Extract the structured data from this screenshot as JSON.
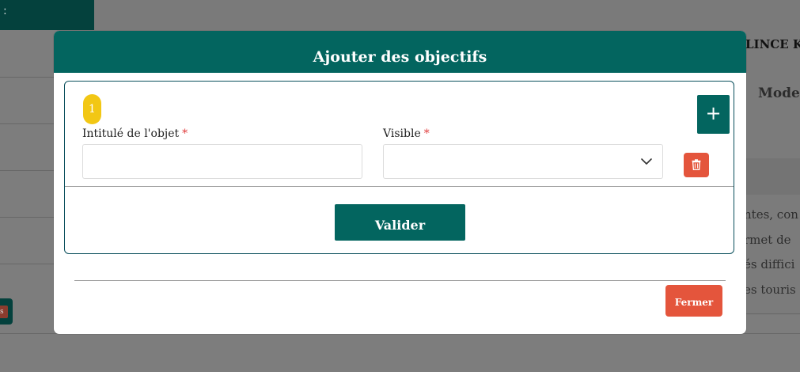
{
  "background": {
    "topbar_menu_glyph": ":",
    "profile_name": "LINCE KA",
    "mode_label": "Mode",
    "description_lines": [
      "ntes, con",
      "rmet de",
      "és diffici",
      "es touris"
    ],
    "sidebar_button_text": "s"
  },
  "modal": {
    "title": "Ajouter des objectifs",
    "objective": {
      "number": "1",
      "title_field": {
        "label": "Intitulé de l'objet",
        "required_mark": "*",
        "value": ""
      },
      "visible_field": {
        "label": "Visible",
        "required_mark": "*",
        "selected": ""
      }
    },
    "add_button_label": "+",
    "submit_label": "Valider",
    "close_label": "Fermer"
  },
  "colors": {
    "primary": "#03655f",
    "danger": "#e4553c",
    "badge": "#f2c714",
    "overlay": "#7d7d7d"
  },
  "icons": {
    "add": "plus-icon",
    "delete": "trash-icon",
    "select": "chevron-down-icon"
  }
}
